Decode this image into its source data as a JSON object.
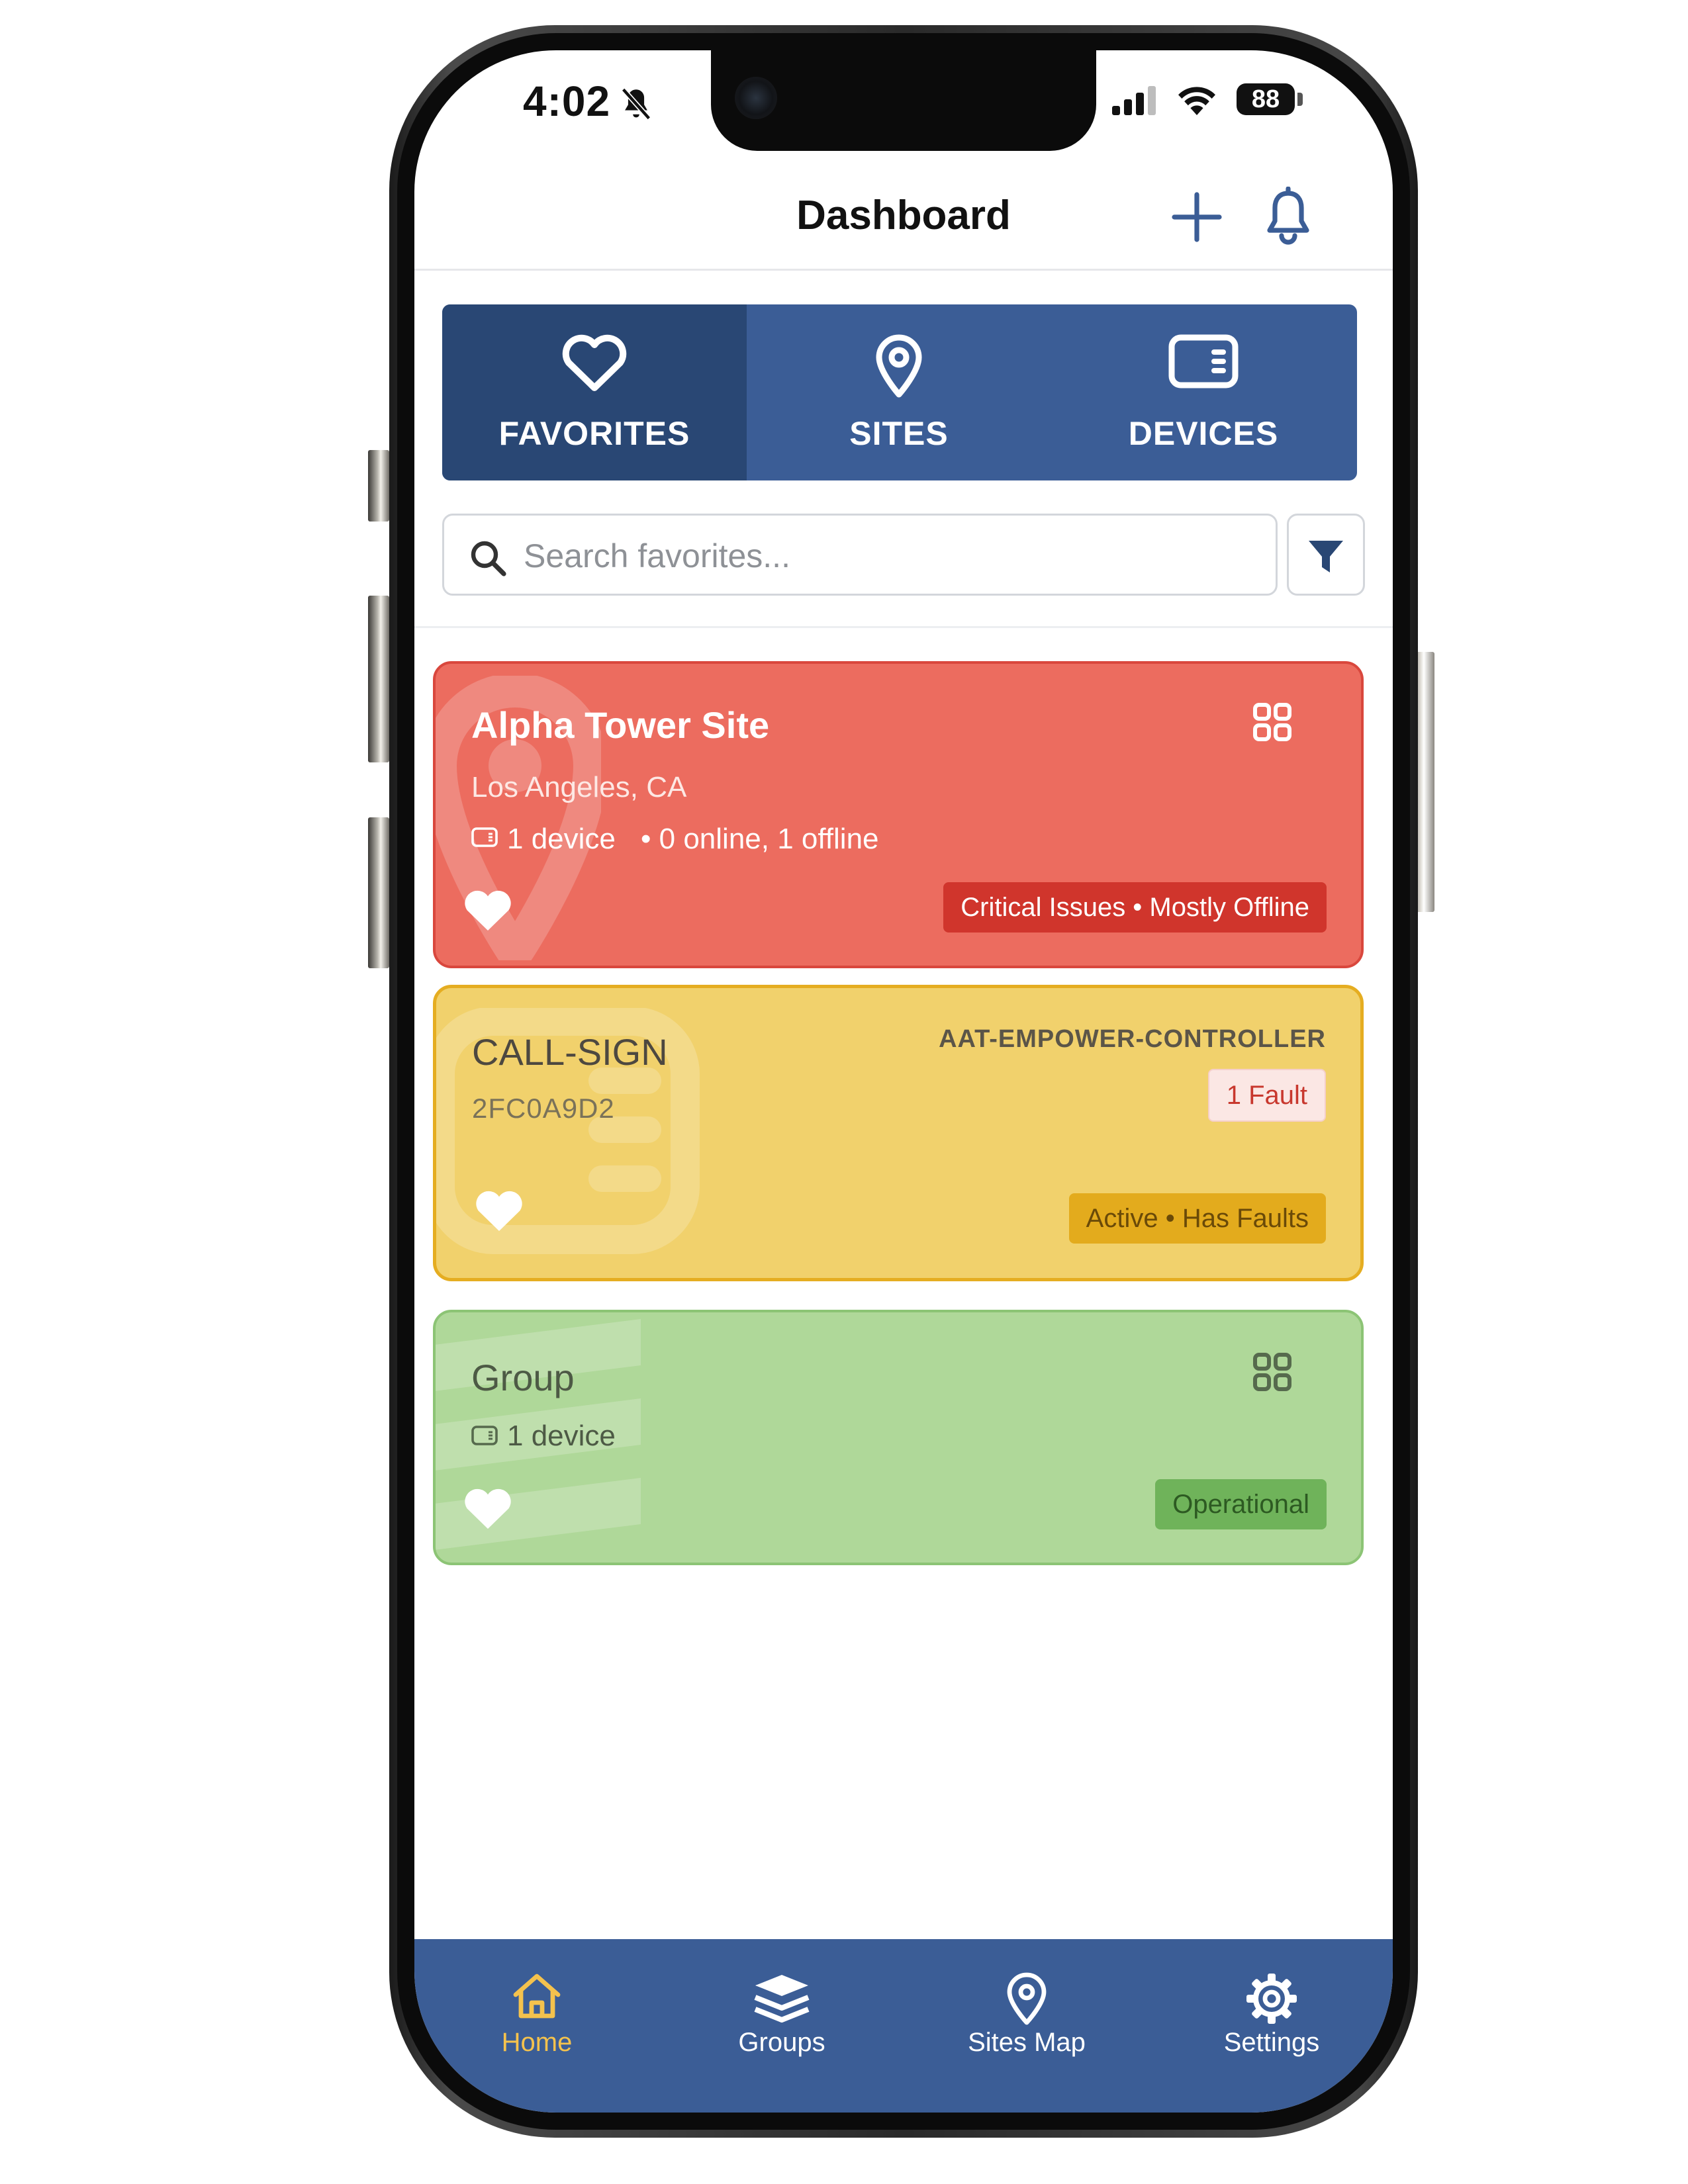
{
  "status_bar": {
    "time": "4:02",
    "battery": "88"
  },
  "header": {
    "title": "Dashboard"
  },
  "tabs": [
    {
      "label": "FAVORITES",
      "icon": "heart-icon",
      "active": true
    },
    {
      "label": "SITES",
      "icon": "map-pin-icon",
      "active": false
    },
    {
      "label": "DEVICES",
      "icon": "device-icon",
      "active": false
    }
  ],
  "search": {
    "placeholder": "Search favorites...",
    "value": ""
  },
  "cards": [
    {
      "kind": "site",
      "title": "Alpha Tower Site",
      "location": "Los Angeles, CA",
      "device_count": "1 device",
      "status_summary": "• 0 online, 1 offline",
      "badge": "Critical Issues • Mostly Offline",
      "favorite": true,
      "color": "#ec6c5f"
    },
    {
      "kind": "device",
      "title": "CALL-SIGN",
      "serial": "2FC0A9D2",
      "model": "AAT-EMPOWER-CONTROLLER",
      "fault_badge": "1 Fault",
      "badge": "Active • Has Faults",
      "favorite": true,
      "color": "#f1d16c"
    },
    {
      "kind": "group",
      "title": "Group",
      "device_count": "1 device",
      "badge": "Operational",
      "favorite": true,
      "color": "#afd899"
    }
  ],
  "bottom_nav": [
    {
      "label": "Home",
      "icon": "home-icon",
      "active": true
    },
    {
      "label": "Groups",
      "icon": "layers-icon",
      "active": false
    },
    {
      "label": "Sites Map",
      "icon": "map-pin-icon",
      "active": false
    },
    {
      "label": "Settings",
      "icon": "gear-icon",
      "active": false
    }
  ],
  "colors": {
    "brand_blue": "#3b5d96",
    "active_tab": "#294774",
    "nav_active": "#f4c24d"
  }
}
